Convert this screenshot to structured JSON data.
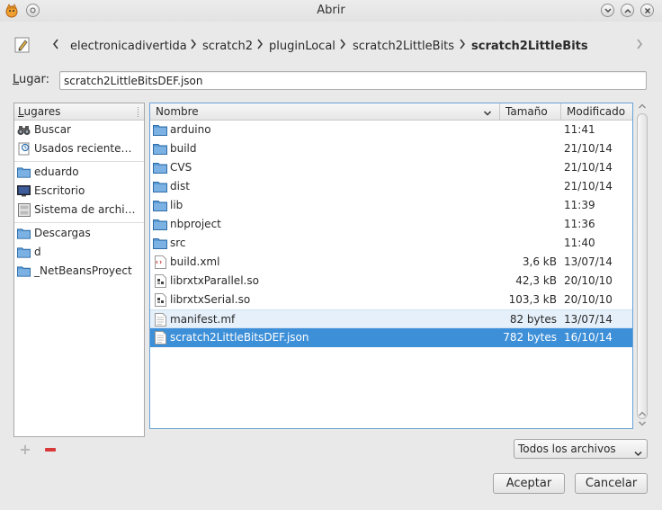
{
  "window": {
    "title": "Abrir"
  },
  "pathbar": {
    "crumbs": [
      "electronicadivertida",
      "scratch2",
      "pluginLocal",
      "scratch2LittleBits",
      "scratch2LittleBits"
    ]
  },
  "location": {
    "label_prefix": "L",
    "label_rest": "ugar:",
    "value": "scratch2LittleBitsDEF.json"
  },
  "places": {
    "header_prefix": "L",
    "header_rest": "ugares",
    "items": [
      {
        "label": "Buscar",
        "icon": "binoculars-icon"
      },
      {
        "label": "Usados reciente…",
        "icon": "recent-documents-icon"
      },
      {
        "label": "eduardo",
        "icon": "folder-icon"
      },
      {
        "label": "Escritorio",
        "icon": "desktop-icon"
      },
      {
        "label": "Sistema de archi…",
        "icon": "filesystem-icon"
      },
      {
        "label": "Descargas",
        "icon": "folder-icon"
      },
      {
        "label": "d",
        "icon": "folder-icon"
      },
      {
        "label": "_NetBeansProyect",
        "icon": "folder-icon"
      }
    ]
  },
  "file_list": {
    "columns": {
      "name": "Nombre",
      "size": "Tamaño",
      "modified": "Modificado"
    },
    "rows": [
      {
        "name": "arduino",
        "size": "",
        "modified": "11:41",
        "icon": "folder-icon"
      },
      {
        "name": "build",
        "size": "",
        "modified": "21/10/14",
        "icon": "folder-icon"
      },
      {
        "name": "CVS",
        "size": "",
        "modified": "21/10/14",
        "icon": "folder-icon"
      },
      {
        "name": "dist",
        "size": "",
        "modified": "21/10/14",
        "icon": "folder-icon"
      },
      {
        "name": "lib",
        "size": "",
        "modified": "11:39",
        "icon": "folder-icon"
      },
      {
        "name": "nbproject",
        "size": "",
        "modified": "11:36",
        "icon": "folder-icon"
      },
      {
        "name": "src",
        "size": "",
        "modified": "11:40",
        "icon": "folder-icon"
      },
      {
        "name": "build.xml",
        "size": "3,6 kB",
        "modified": "13/07/14",
        "icon": "xml-file-icon"
      },
      {
        "name": "librxtxParallel.so",
        "size": "42,3 kB",
        "modified": "20/10/10",
        "icon": "library-file-icon"
      },
      {
        "name": "librxtxSerial.so",
        "size": "103,3 kB",
        "modified": "20/10/10",
        "icon": "library-file-icon"
      },
      {
        "name": "manifest.mf",
        "size": "82 bytes",
        "modified": "13/07/14",
        "icon": "text-file-icon"
      },
      {
        "name": "scratch2LittleBitsDEF.json",
        "size": "782 bytes",
        "modified": "16/10/14",
        "icon": "text-file-icon"
      }
    ],
    "highlighted_index": 10,
    "selected_index": 11
  },
  "filter": {
    "value": "Todos los archivos"
  },
  "buttons": {
    "accept": "Aceptar",
    "cancel": "Cancelar"
  },
  "colors": {
    "selection": "#3d8fd8",
    "folder": "#5b9bd5",
    "remove": "#d83a3a"
  }
}
